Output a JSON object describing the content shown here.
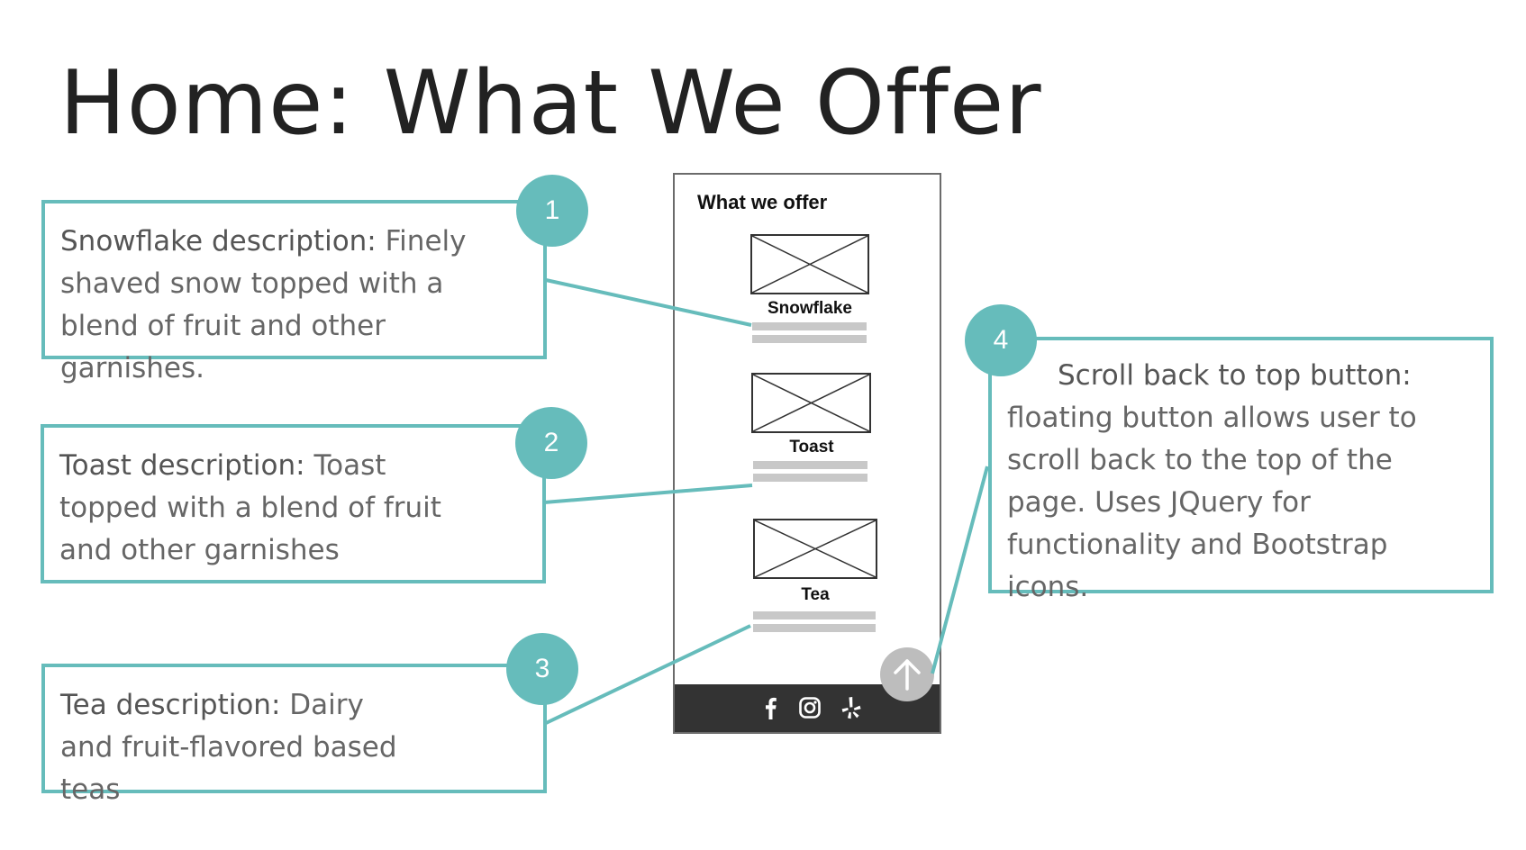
{
  "title": "Home: What We Offer",
  "colors": {
    "accent": "#66bcbb",
    "footer": "#333333",
    "scroll_button": "#bdbdbd",
    "placeholder_bar": "#c8c8c8"
  },
  "callouts": [
    {
      "number": "1",
      "label": "Snowflake description:",
      "text": " Finely shaved snow topped with a blend of fruit and other garnishes."
    },
    {
      "number": "2",
      "label": "Toast description:",
      "text": " Toast topped with a blend of fruit and other garnishes"
    },
    {
      "number": "3",
      "label": "Tea description:",
      "text": " Dairy and fruit-flavored based teas"
    },
    {
      "number": "4",
      "label": "Scroll back to top button:",
      "text": " floating button allows user to scroll back to the top of the page. Uses JQuery for functionality and Bootstrap icons."
    }
  ],
  "phone": {
    "heading": "What we offer",
    "items": [
      {
        "name": "Snowflake"
      },
      {
        "name": "Toast"
      },
      {
        "name": "Tea"
      }
    ],
    "footer_icons": [
      "facebook-icon",
      "instagram-icon",
      "yelp-icon"
    ],
    "scroll_button_icon": "arrow-up-icon"
  }
}
